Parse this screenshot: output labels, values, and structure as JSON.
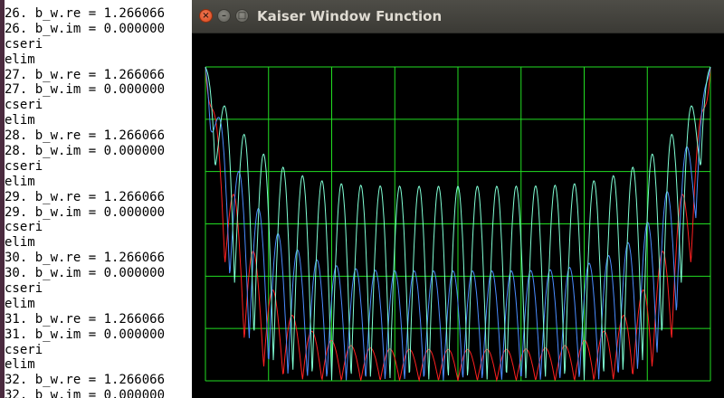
{
  "terminal": {
    "lines": [
      "26. b_w.re = 1.266066",
      "26. b_w.im = 0.000000",
      "cseri",
      "elim",
      "27. b_w.re = 1.266066",
      "27. b_w.im = 0.000000",
      "cseri",
      "elim",
      "28. b_w.re = 1.266066",
      "28. b_w.im = 0.000000",
      "cseri",
      "elim",
      "29. b_w.re = 1.266066",
      "29. b_w.im = 0.000000",
      "cseri",
      "elim",
      "30. b_w.re = 1.266066",
      "30. b_w.im = 0.000000",
      "cseri",
      "elim",
      "31. b_w.re = 1.266066",
      "31. b_w.im = 0.000000",
      "cseri",
      "elim",
      "32. b_w.re = 1.266066",
      "32. b_w.im = 0.000000"
    ]
  },
  "window": {
    "title": "Kaiser Window Function",
    "close_glyph": "×",
    "minimize_glyph": "–",
    "maximize_glyph": "□"
  },
  "colors": {
    "grid": "#22dd22",
    "background": "#000000",
    "series_red": "#ff2020",
    "series_blue": "#4a8cff",
    "series_cyan": "#7fffd4"
  },
  "chart_data": {
    "type": "line",
    "grid": true,
    "grid_divisions": {
      "x": 8,
      "y": 6
    },
    "series": [
      {
        "color": "red",
        "lobes": 26,
        "minimum_level": 0.1
      },
      {
        "color": "blue",
        "lobes": 26,
        "minimum_level": 0.35
      },
      {
        "color": "cyan",
        "lobes": 26,
        "minimum_level": 0.62
      }
    ]
  }
}
